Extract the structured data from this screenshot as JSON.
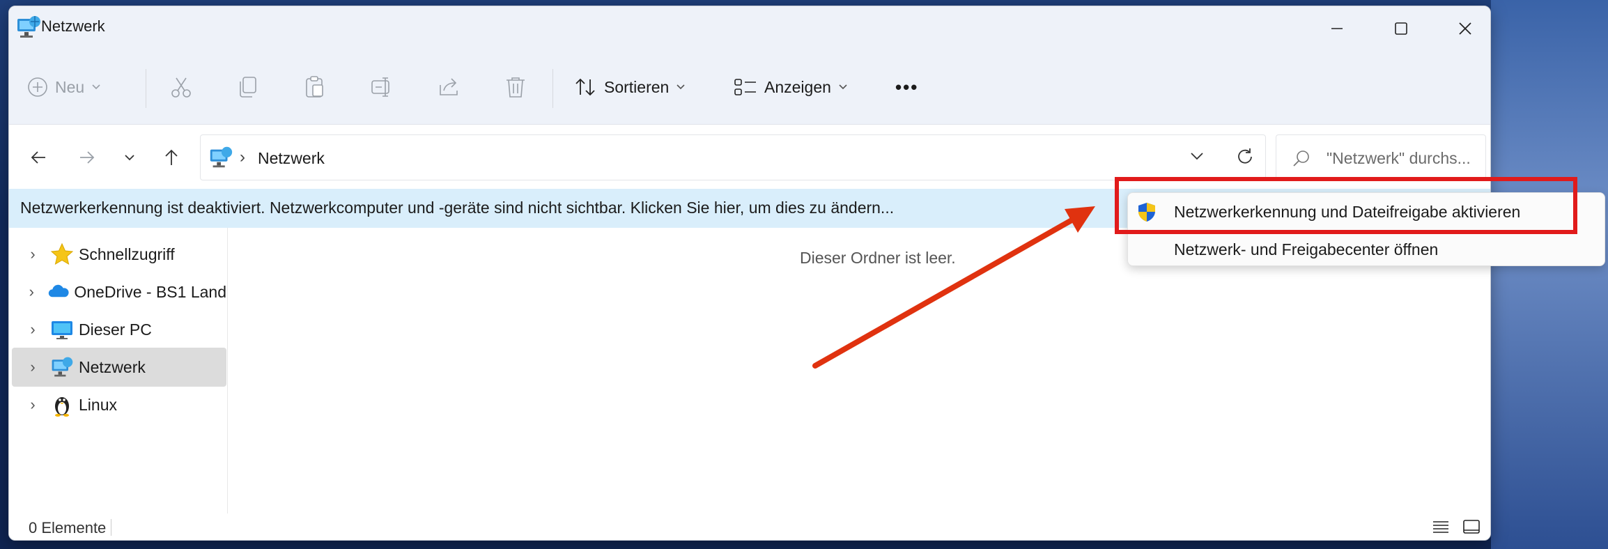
{
  "window": {
    "title": "Netzwerk"
  },
  "toolbar": {
    "new_label": "Neu",
    "sort_label": "Sortieren",
    "view_label": "Anzeigen",
    "more_label": "•••"
  },
  "address": {
    "path": "Netzwerk",
    "separator": "›"
  },
  "search": {
    "placeholder": "\"Netzwerk\" durchs..."
  },
  "infobar": {
    "text": "Netzwerkerkennung ist deaktiviert. Netzwerkcomputer und -geräte sind nicht sichtbar. Klicken Sie hier, um dies zu ändern..."
  },
  "sidebar": {
    "items": [
      {
        "label": "Schnellzugriff",
        "icon": "star-icon"
      },
      {
        "label": "OneDrive - BS1 Land",
        "icon": "cloud-icon"
      },
      {
        "label": "Dieser PC",
        "icon": "monitor-icon"
      },
      {
        "label": "Netzwerk",
        "icon": "network-icon",
        "selected": true
      },
      {
        "label": "Linux",
        "icon": "penguin-icon"
      }
    ]
  },
  "content": {
    "empty_message": "Dieser Ordner ist leer."
  },
  "status": {
    "count": "0 Elemente"
  },
  "context_menu": {
    "items": [
      {
        "label": "Netzwerkerkennung und Dateifreigabe aktivieren",
        "icon": "uac-shield-icon"
      },
      {
        "label": "Netzwerk- und Freigabecenter öffnen"
      }
    ]
  },
  "colors": {
    "highlight": "#e11b1b",
    "arrow": "#e0320f",
    "infobar": "#d9eefb"
  }
}
